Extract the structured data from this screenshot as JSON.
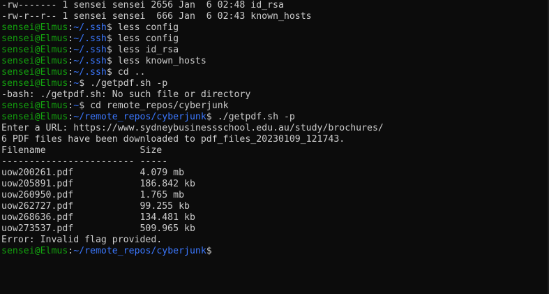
{
  "theme": {
    "background": "#0c0c0c",
    "foreground": "#cccccc",
    "prompt_user_color": "#13a10e",
    "prompt_path_color": "#3b78ff"
  },
  "lines": [
    {
      "type": "text",
      "text": "-rw------- 1 sensei sensei 2656 Jan  6 02:48 id_rsa"
    },
    {
      "type": "text",
      "text": "-rw-r--r-- 1 sensei sensei  666 Jan  6 02:43 known_hosts"
    },
    {
      "type": "prompt",
      "user": "sensei@Elmus",
      "sep": ":",
      "path": "~/.ssh",
      "symbol": "$",
      "command": " less config"
    },
    {
      "type": "prompt",
      "user": "sensei@Elmus",
      "sep": ":",
      "path": "~/.ssh",
      "symbol": "$",
      "command": " less config"
    },
    {
      "type": "prompt",
      "user": "sensei@Elmus",
      "sep": ":",
      "path": "~/.ssh",
      "symbol": "$",
      "command": " less id_rsa"
    },
    {
      "type": "prompt",
      "user": "sensei@Elmus",
      "sep": ":",
      "path": "~/.ssh",
      "symbol": "$",
      "command": " less known_hosts"
    },
    {
      "type": "prompt",
      "user": "sensei@Elmus",
      "sep": ":",
      "path": "~/.ssh",
      "symbol": "$",
      "command": " cd .."
    },
    {
      "type": "prompt",
      "user": "sensei@Elmus",
      "sep": ":",
      "path": "~",
      "symbol": "$",
      "command": " ./getpdf.sh -p"
    },
    {
      "type": "text",
      "text": "-bash: ./getpdf.sh: No such file or directory"
    },
    {
      "type": "prompt",
      "user": "sensei@Elmus",
      "sep": ":",
      "path": "~",
      "symbol": "$",
      "command": " cd remote_repos/cyberjunk"
    },
    {
      "type": "prompt",
      "user": "sensei@Elmus",
      "sep": ":",
      "path": "~/remote_repos/cyberjunk",
      "symbol": "$",
      "command": " ./getpdf.sh -p"
    },
    {
      "type": "text",
      "text": "Enter a URL: https://www.sydneybusinessschool.edu.au/study/brochures/"
    },
    {
      "type": "text",
      "text": "6 PDF files have been downloaded to pdf_files_20230109_121743."
    },
    {
      "type": "text",
      "text": "Filename                 Size"
    },
    {
      "type": "text",
      "text": "------------------------ -----"
    },
    {
      "type": "text",
      "text": "uow200261.pdf            4.079 mb"
    },
    {
      "type": "text",
      "text": "uow205891.pdf            186.842 kb"
    },
    {
      "type": "text",
      "text": "uow260950.pdf            1.765 mb"
    },
    {
      "type": "text",
      "text": "uow262727.pdf            99.255 kb"
    },
    {
      "type": "text",
      "text": "uow268636.pdf            134.481 kb"
    },
    {
      "type": "text",
      "text": "uow273537.pdf            509.965 kb"
    },
    {
      "type": "text",
      "text": "Error: Invalid flag provided."
    },
    {
      "type": "prompt",
      "user": "sensei@Elmus",
      "sep": ":",
      "path": "~/remote_repos/cyberjunk",
      "symbol": "$",
      "command": ""
    }
  ]
}
